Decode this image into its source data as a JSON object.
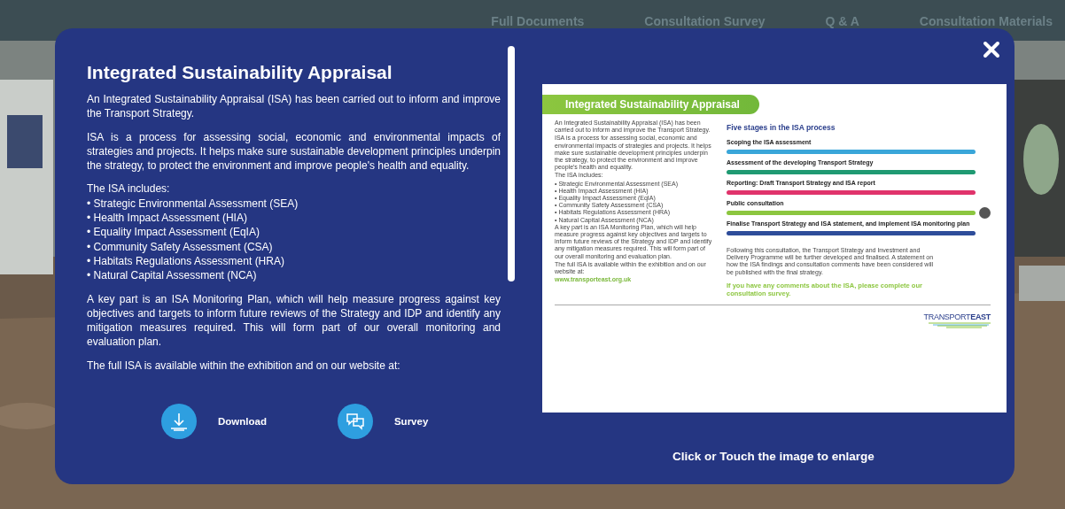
{
  "nav": [
    {
      "label": "Full Documents"
    },
    {
      "label": "Consultation Survey"
    },
    {
      "label": "Q & A"
    },
    {
      "label": "Consultation Materials"
    }
  ],
  "modal": {
    "title": "Integrated Sustainability Appraisal",
    "paragraphs": [
      "An Integrated Sustainability Appraisal (ISA) has been carried out to inform and improve the Transport Strategy.",
      "ISA is a process for assessing social, economic and environmental impacts of strategies and projects. It helps make sure sustainable development principles underpin the strategy, to protect the environment and improve people's health and equality."
    ],
    "includes_heading": "The ISA includes:",
    "includes": [
      "• Strategic Environmental Assessment (SEA)",
      "• Health Impact Assessment (HIA)",
      "• Equality Impact Assessment (EqIA)",
      "• Community Safety Assessment (CSA)",
      "• Habitats Regulations Assessment (HRA)",
      "• Natural Capital Assessment (NCA)"
    ],
    "closing": [
      "A key part is an ISA Monitoring Plan, which will help measure progress against key objectives and targets to inform future reviews of the Strategy and IDP and identify any mitigation measures required. This will form part of our overall monitoring and evaluation plan.",
      "The full ISA is available within the exhibition and on our website at:"
    ],
    "actions": [
      {
        "kind": "download",
        "label": "Download"
      },
      {
        "kind": "survey",
        "label": "Survey"
      }
    ],
    "hint": "Click or Touch the  image to enlarge",
    "document": {
      "heading": "Integrated Sustainability Appraisal",
      "left": [
        "An Integrated Sustainability Appraisal (ISA) has been carried out to inform and improve the Transport Strategy.",
        "ISA is a process for assessing social, economic and environmental impacts of strategies and projects. It helps make sure sustainable development principles underpin the strategy, to protect the environment and improve people's health and equality.",
        "The ISA includes:"
      ],
      "list": [
        "• Strategic Environmental Assessment (SEA)",
        "• Health Impact Assessment (HIA)",
        "• Equality Impact Assessment (EqIA)",
        "• Community Safety Assessment (CSA)",
        "• Habitats Regulations Assessment (HRA)",
        "• Natural Capital Assessment (NCA)"
      ],
      "left_end": [
        "A key part is an ISA Monitoring Plan, which will help measure progress against key objectives and targets to inform future reviews of the Strategy and IDP and identify any mitigation measures required. This will form part of our overall monitoring and evaluation plan.",
        "The full ISA is available within the exhibition and on our website at:"
      ],
      "link": "www.transporteast.org.uk",
      "stages_title": "Five stages in the ISA process",
      "stages": [
        {
          "label": "Scoping the ISA assessment",
          "color": "#3aa6d9",
          "current": false
        },
        {
          "label": "Assessment of the developing Transport Strategy",
          "color": "#1f9a72",
          "current": false
        },
        {
          "label": "Reporting: Draft Transport Strategy and ISA report",
          "color": "#e0336b",
          "current": false
        },
        {
          "label": "Public consultation",
          "color": "#8cc63f",
          "current": true
        },
        {
          "label": "Finalise Transport Strategy and ISA statement, and implement ISA monitoring plan",
          "color": "#2e4d9a",
          "current": false
        }
      ],
      "following": "Following this consultation, the Transport Strategy and Investment and Delivery Programme will be further developed and finalised. A statement on how the ISA findings and consultation comments have been considered will be published with the final strategy.",
      "call": "If you have any comments about the ISA, please complete our consultation survey.",
      "logo": "TRANSPORT**EAST**"
    }
  }
}
